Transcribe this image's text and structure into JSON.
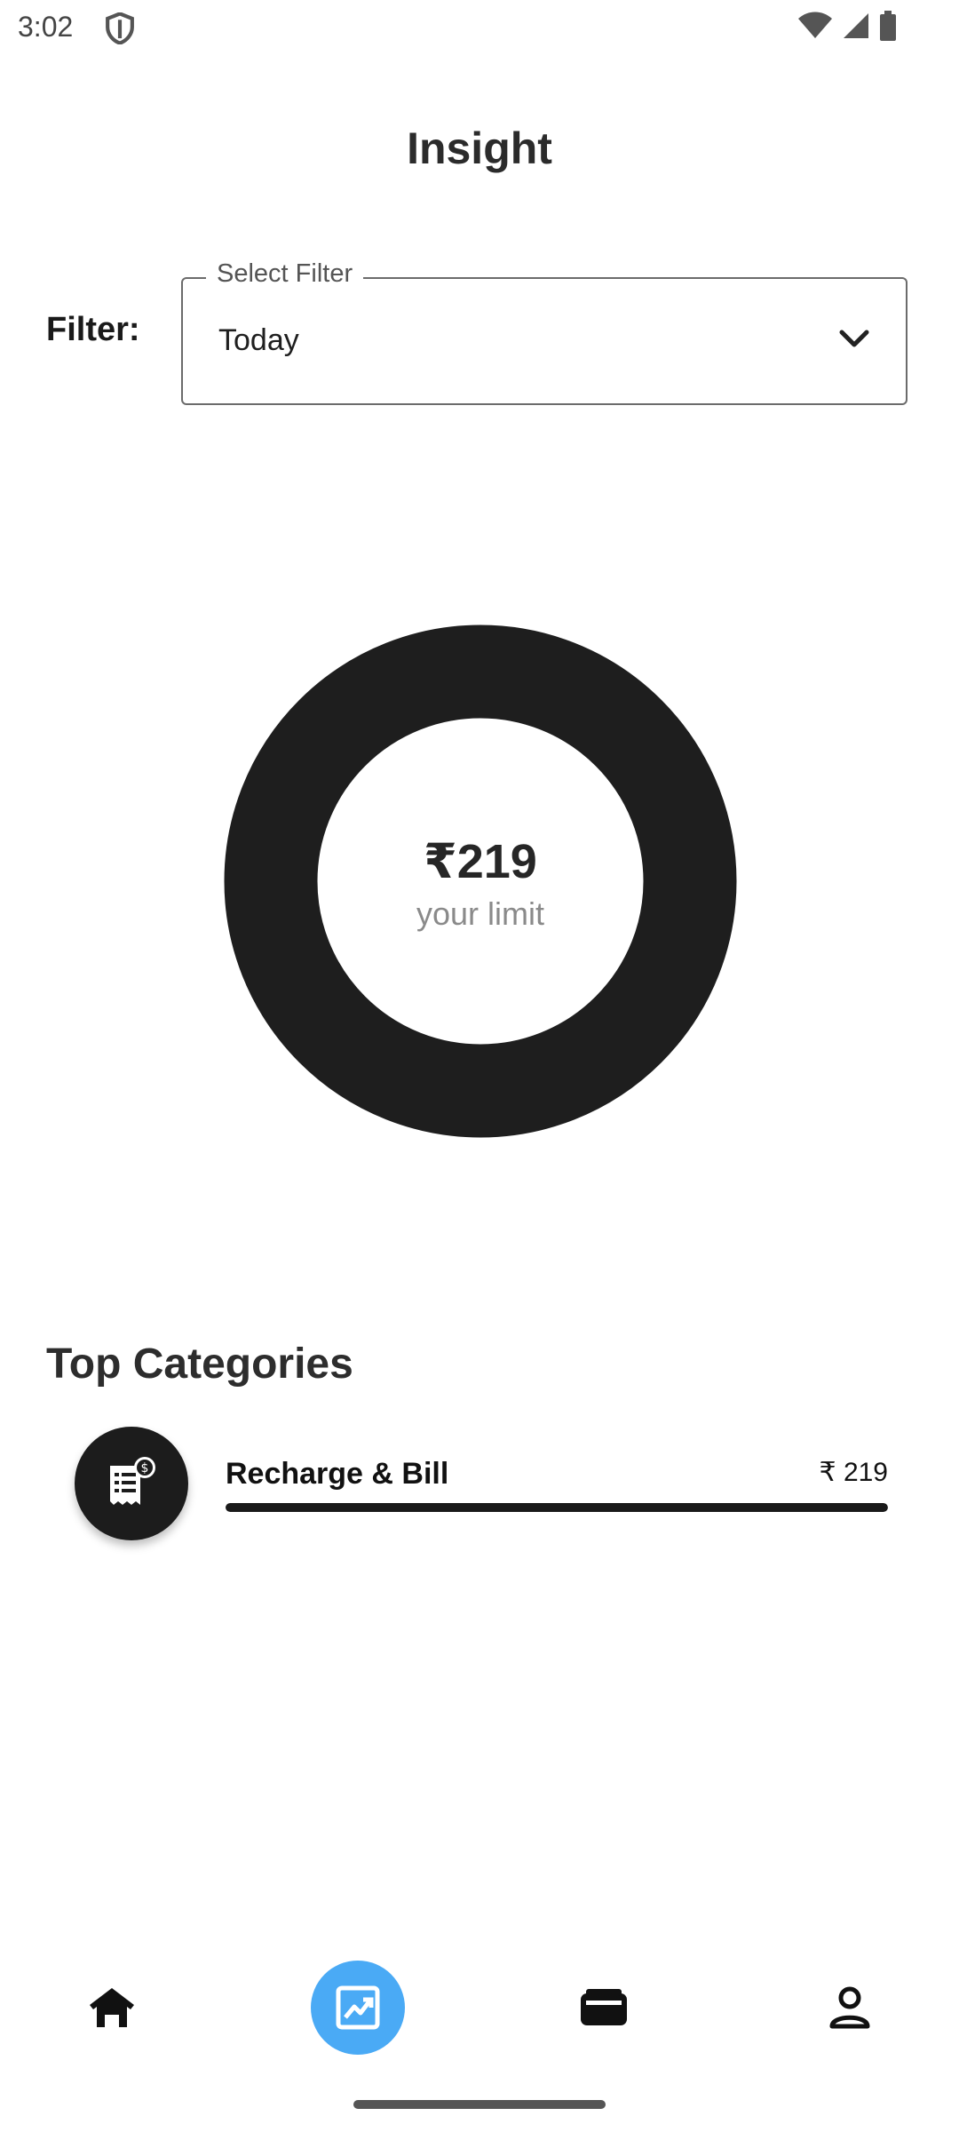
{
  "status_bar": {
    "time": "3:02"
  },
  "header": {
    "title": "Insight"
  },
  "filter": {
    "label": "Filter:",
    "select_legend": "Select Filter",
    "selected_value": "Today"
  },
  "donut": {
    "amount": "₹219",
    "caption": "your limit",
    "ring_color": "#1e1e1e"
  },
  "categories": {
    "title": "Top Categories",
    "items": [
      {
        "name": "Recharge & Bill",
        "amount": "₹ 219",
        "icon": "bill-receipt-icon",
        "fraction": 1.0
      }
    ]
  },
  "bottom_nav": {
    "items": [
      {
        "icon": "home-icon",
        "active": false
      },
      {
        "icon": "insight-chart-icon",
        "active": true
      },
      {
        "icon": "wallet-icon",
        "active": false
      },
      {
        "icon": "profile-icon",
        "active": false
      }
    ],
    "active_color": "#4aaaf5"
  }
}
